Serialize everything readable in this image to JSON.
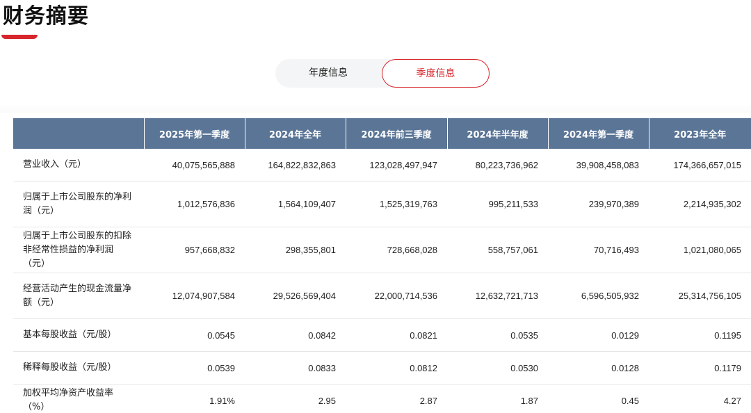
{
  "header": {
    "title": "财务摘要",
    "accent_color": "#d7262b"
  },
  "toggle": {
    "annual_label": "年度信息",
    "quarter_label": "季度信息",
    "active": "quarter"
  },
  "table": {
    "header_color": "#5a7596",
    "columns": [
      "",
      "2025年第一季度",
      "2024年全年",
      "2024年前三季度",
      "2024年半年度",
      "2024年第一季度",
      "2023年全年"
    ],
    "rows": [
      {
        "label": "营业收入（元）",
        "values": [
          "40,075,565,888",
          "164,822,832,863",
          "123,028,497,947",
          "80,223,736,962",
          "39,908,458,083",
          "174,366,657,015"
        ]
      },
      {
        "label": "归属于上市公司股东的净利润（元）",
        "values": [
          "1,012,576,836",
          "1,564,109,407",
          "1,525,319,763",
          "995,211,533",
          "239,970,389",
          "2,214,935,302"
        ]
      },
      {
        "label": "归属于上市公司股东的扣除非经常性损益的净利润（元）",
        "values": [
          "957,668,832",
          "298,355,801",
          "728,668,028",
          "558,757,061",
          "70,716,493",
          "1,021,080,065"
        ]
      },
      {
        "label": "经营活动产生的现金流量净额（元）",
        "values": [
          "12,074,907,584",
          "29,526,569,404",
          "22,000,714,536",
          "12,632,721,713",
          "6,596,505,932",
          "25,314,756,105"
        ]
      },
      {
        "label": "基本每股收益（元/股）",
        "values": [
          "0.0545",
          "0.0842",
          "0.0821",
          "0.0535",
          "0.0129",
          "0.1195"
        ]
      },
      {
        "label": "稀释每股收益（元/股）",
        "values": [
          "0.0539",
          "0.0833",
          "0.0812",
          "0.0530",
          "0.0128",
          "0.1179"
        ]
      },
      {
        "label": "加权平均净资产收益率（%）",
        "values": [
          "1.91%",
          "2.95",
          "2.87",
          "1.87",
          "0.45",
          "4.27"
        ]
      }
    ]
  }
}
